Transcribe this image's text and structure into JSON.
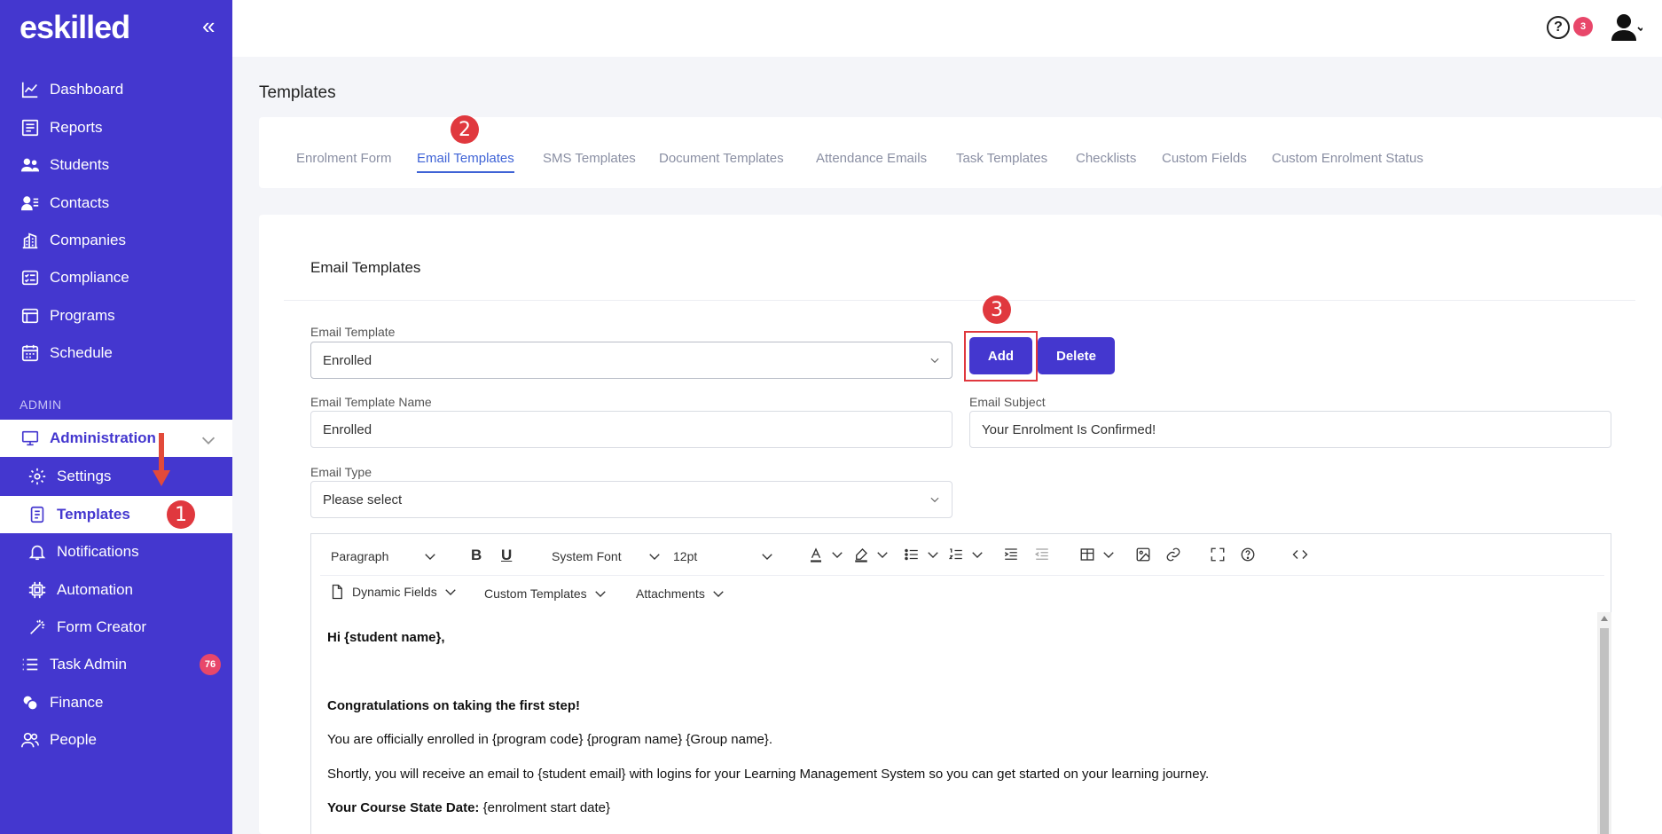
{
  "app": {
    "logo": "eskilled",
    "collapse": "«"
  },
  "sidebar": {
    "items": [
      {
        "label": "Dashboard"
      },
      {
        "label": "Reports"
      },
      {
        "label": "Students"
      },
      {
        "label": "Contacts"
      },
      {
        "label": "Companies"
      },
      {
        "label": "Compliance"
      },
      {
        "label": "Programs"
      },
      {
        "label": "Schedule"
      }
    ],
    "section_label": "ADMIN",
    "administration": "Administration",
    "sub_items": [
      {
        "label": "Settings"
      },
      {
        "label": "Templates"
      },
      {
        "label": "Notifications"
      },
      {
        "label": "Automation"
      },
      {
        "label": "Form Creator"
      }
    ],
    "task_admin": "Task Admin",
    "task_admin_badge": "76",
    "finance": "Finance",
    "people": "People"
  },
  "topbar": {
    "help": "?",
    "notif_count": "3"
  },
  "page": {
    "title": "Templates"
  },
  "tabs": [
    {
      "label": "Enrolment Form"
    },
    {
      "label": "Email Templates"
    },
    {
      "label": "SMS Templates"
    },
    {
      "label": "Document Templates"
    },
    {
      "label": "Attendance Emails"
    },
    {
      "label": "Task Templates"
    },
    {
      "label": "Checklists"
    },
    {
      "label": "Custom Fields"
    },
    {
      "label": "Custom Enrolment Status"
    }
  ],
  "steps": [
    "1",
    "2",
    "3"
  ],
  "form": {
    "section_title": "Email Templates",
    "email_template_label": "Email Template",
    "email_template_value": "Enrolled",
    "add_button": "Add",
    "delete_button": "Delete",
    "name_label": "Email Template Name",
    "name_value": "Enrolled",
    "subject_label": "Email Subject",
    "subject_value": "Your Enrolment Is Confirmed!",
    "type_label": "Email Type",
    "type_value": "Please select"
  },
  "editor": {
    "block_format": "Paragraph",
    "bold": "B",
    "underline": "U",
    "font": "System Font",
    "size": "12pt",
    "dynamic_fields": "Dynamic Fields",
    "custom_templates": "Custom Templates",
    "attachments": "Attachments",
    "greeting": "Hi {student name},",
    "congrats": "Congratulations on taking the first step!",
    "line1": "You are officially enrolled in {program code} {program name} {Group name}.",
    "line2": "Shortly, you will receive an email to {student email} with logins for your Learning Management System so you can get started on your learning journey.",
    "start_label": "Your Course State Date:",
    "start_value": "{enrolment start date}"
  },
  "colors": {
    "sidebar": "#4437cf",
    "accent_tab": "#3f63d6",
    "badge": "#e8476a",
    "step": "#e0383e"
  }
}
